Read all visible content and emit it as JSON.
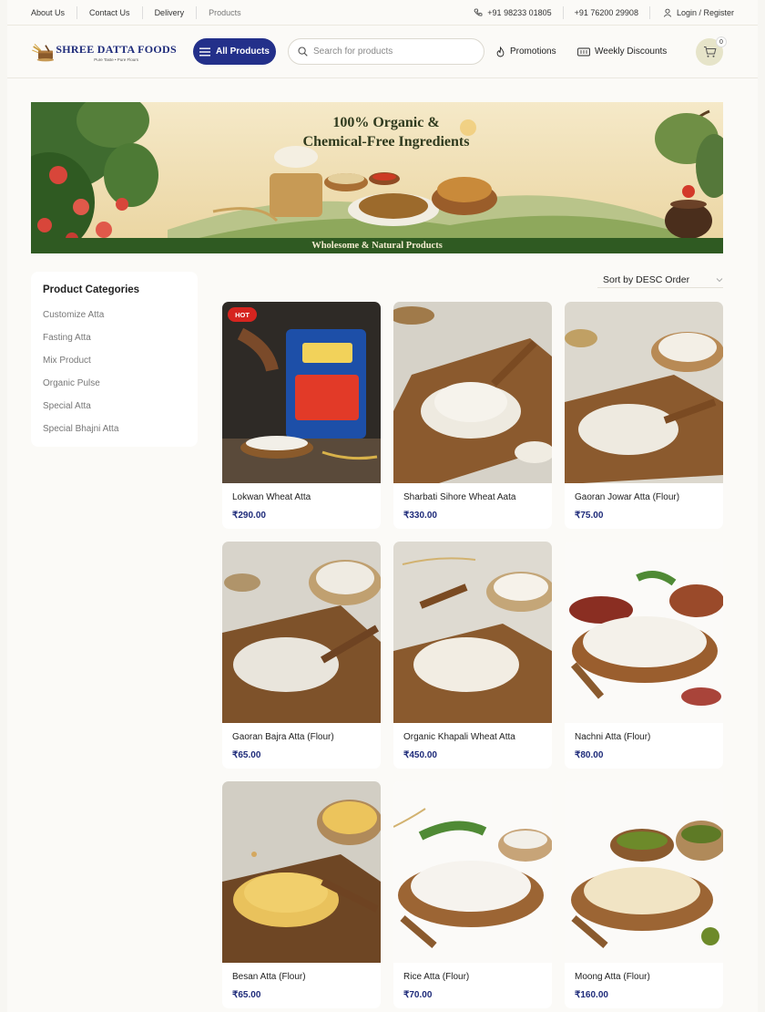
{
  "topbar": {
    "links": [
      "About Us",
      "Contact Us",
      "Delivery",
      "Products"
    ],
    "phones": [
      "+91 98233 01805",
      "+91 76200 29908"
    ],
    "login": "Login / Register"
  },
  "header": {
    "logo_name": "SHREE DATTA FOODS",
    "logo_tagline": "Pure Taste • Pure Flours",
    "all_products_label": "All Products",
    "search_placeholder": "Search for products",
    "promotions_label": "Promotions",
    "weekly_discounts_label": "Weekly Discounts",
    "cart_count": "0"
  },
  "banner": {
    "title_line1": "100% Organic &",
    "title_line2": "Chemical-Free Ingredients",
    "footer": "Wholesome & Natural Products"
  },
  "sidebar": {
    "title": "Product Categories",
    "categories": [
      "Customize Atta",
      "Fasting Atta",
      "Mix Product",
      "Organic Pulse",
      "Special Atta",
      "Special Bhajni Atta"
    ]
  },
  "sort": {
    "label": "Sort by DESC Order"
  },
  "products": [
    {
      "name": "Lokwan Wheat Atta",
      "price": "₹290.00",
      "badge": "HOT"
    },
    {
      "name": "Sharbati Sihore Wheat Aata",
      "price": "₹330.00"
    },
    {
      "name": "Gaoran Jowar Atta (Flour)",
      "price": "₹75.00"
    },
    {
      "name": "Gaoran Bajra Atta (Flour)",
      "price": "₹65.00"
    },
    {
      "name": "Organic Khapali Wheat Atta",
      "price": "₹450.00"
    },
    {
      "name": "Nachni Atta (Flour)",
      "price": "₹80.00"
    },
    {
      "name": "Besan Atta (Flour)",
      "price": "₹65.00"
    },
    {
      "name": "Rice Atta (Flour)",
      "price": "₹70.00"
    },
    {
      "name": "Moong Atta (Flour)",
      "price": "₹160.00"
    }
  ],
  "colors": {
    "brand_navy": "#23308a",
    "hot_red": "#d6241f",
    "cart_bg": "#e6e4c9"
  }
}
